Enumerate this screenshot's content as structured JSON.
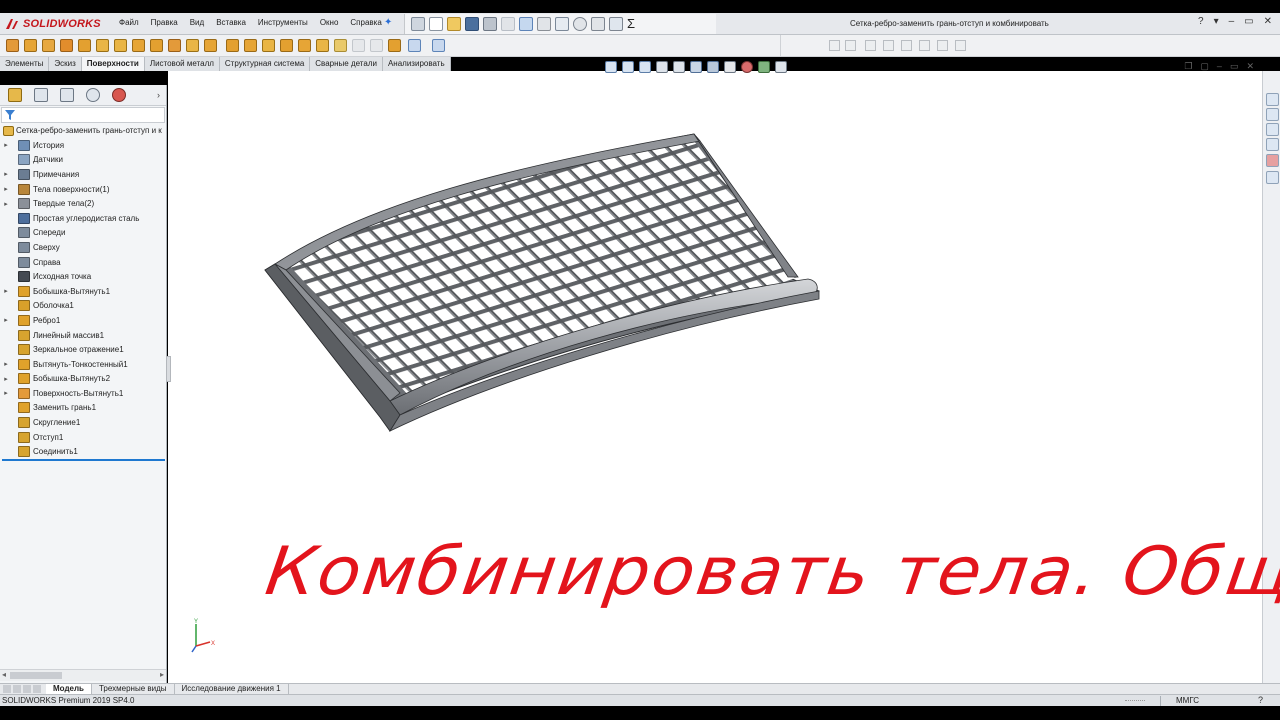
{
  "app": {
    "logo_text_ds": "3S",
    "logo_text": "SOLIDWORKS",
    "document_title": "Сетка-ребро-заменить грань-отступ и комбинировать",
    "brand_color": "#c4161c"
  },
  "menu": [
    "Файл",
    "Правка",
    "Вид",
    "Вставка",
    "Инструменты",
    "Окно",
    "Справка"
  ],
  "window_controls": {
    "help": "?",
    "help_caret": "▾",
    "minimize": "–",
    "restore": "▭",
    "close": "✕"
  },
  "command_tabs": [
    {
      "label": "Элементы",
      "active": false
    },
    {
      "label": "Эскиз",
      "active": false
    },
    {
      "label": "Поверхности",
      "active": true
    },
    {
      "label": "Листовой металл",
      "active": false
    },
    {
      "label": "Структурная система",
      "active": false
    },
    {
      "label": "Сварные детали",
      "active": false
    },
    {
      "label": "Анализировать",
      "active": false
    }
  ],
  "feature_tree": {
    "root": "Сетка-ребро-заменить грань-отступ и к",
    "nodes": [
      {
        "label": "История",
        "expandable": true,
        "icon": "history-icon",
        "color": "#6f8fb6"
      },
      {
        "label": "Датчики",
        "expandable": false,
        "icon": "sensor-icon",
        "color": "#8aa4c2"
      },
      {
        "label": "Примечания",
        "expandable": true,
        "icon": "annotation-icon",
        "color": "#6b7d93"
      },
      {
        "label": "Тела поверхности(1)",
        "expandable": true,
        "icon": "surface-bodies-icon",
        "color": "#b8863b"
      },
      {
        "label": "Твердые тела(2)",
        "expandable": true,
        "icon": "solid-bodies-icon",
        "color": "#8b9099"
      },
      {
        "label": "Простая углеродистая сталь",
        "expandable": false,
        "icon": "material-icon",
        "color": "#4d6e9c"
      },
      {
        "label": "Спереди",
        "expandable": false,
        "icon": "plane-icon",
        "color": "#7d8b9c"
      },
      {
        "label": "Сверху",
        "expandable": false,
        "icon": "plane-icon",
        "color": "#7d8b9c"
      },
      {
        "label": "Справа",
        "expandable": false,
        "icon": "plane-icon",
        "color": "#7d8b9c"
      },
      {
        "label": "Исходная точка",
        "expandable": false,
        "icon": "origin-icon",
        "color": "#444a52"
      },
      {
        "label": "Бобышка-Вытянуть1",
        "expandable": true,
        "icon": "extrude-icon",
        "color": "#e0a22b"
      },
      {
        "label": "Оболочка1",
        "expandable": false,
        "icon": "shell-icon",
        "color": "#d9a02a"
      },
      {
        "label": "Ребро1",
        "expandable": true,
        "icon": "rib-icon",
        "color": "#e0a22b"
      },
      {
        "label": "Линейный массив1",
        "expandable": false,
        "icon": "linear-pattern-icon",
        "color": "#d7a42f"
      },
      {
        "label": "Зеркальное отражение1",
        "expandable": false,
        "icon": "mirror-icon",
        "color": "#d7a42f"
      },
      {
        "label": "Вытянуть-Тонкостенный1",
        "expandable": true,
        "icon": "extrude-thin-icon",
        "color": "#e0a22b"
      },
      {
        "label": "Бобышка-Вытянуть2",
        "expandable": true,
        "icon": "extrude-icon",
        "color": "#e0a22b"
      },
      {
        "label": "Поверхность-Вытянуть1",
        "expandable": true,
        "icon": "surface-extrude-icon",
        "color": "#e39a3a"
      },
      {
        "label": "Заменить грань1",
        "expandable": false,
        "icon": "replace-face-icon",
        "color": "#e0a22b"
      },
      {
        "label": "Скругление1",
        "expandable": false,
        "icon": "fillet-icon",
        "color": "#d7a42f"
      },
      {
        "label": "Отступ1",
        "expandable": false,
        "icon": "indent-icon",
        "color": "#d7a42f"
      },
      {
        "label": "Соединить1",
        "expandable": false,
        "icon": "combine-icon",
        "color": "#d7a42f"
      }
    ]
  },
  "overlay_title": "Комбинировать тела. Общие",
  "overlay_color": "#e3141c",
  "triad": {
    "x_label": "X",
    "y_label": "Y"
  },
  "bottom_tabs": [
    {
      "label": "Модель",
      "active": true
    },
    {
      "label": "Трехмерные виды",
      "active": false
    },
    {
      "label": "Исследование движения 1",
      "active": false
    }
  ],
  "status_bar": {
    "product": "SOLIDWORKS Premium 2019 SP4.0",
    "units": "ММГС",
    "help": "?"
  }
}
